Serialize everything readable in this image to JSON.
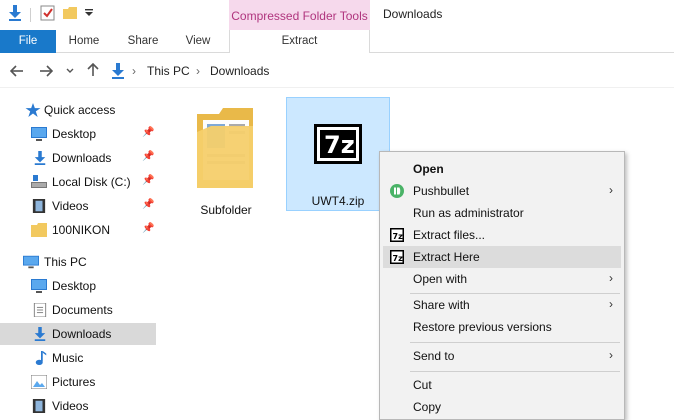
{
  "titlebar": {
    "context_tab": "Compressed Folder Tools",
    "window_title": "Downloads"
  },
  "ribbon": {
    "tabs": [
      {
        "label": "File"
      },
      {
        "label": "Home"
      },
      {
        "label": "Share"
      },
      {
        "label": "View"
      },
      {
        "label": "Extract"
      }
    ]
  },
  "address": {
    "crumbs": [
      "This PC",
      "Downloads"
    ]
  },
  "nav": {
    "quick_access": "Quick access",
    "items": [
      {
        "label": "Desktop",
        "icon": "desktop-icon"
      },
      {
        "label": "Downloads",
        "icon": "download-arrow-icon"
      },
      {
        "label": "Local Disk (C:)",
        "icon": "drive-icon"
      },
      {
        "label": "Videos",
        "icon": "film-icon"
      },
      {
        "label": "100NIKON",
        "icon": "folder-icon"
      }
    ],
    "this_pc": "This PC",
    "pc_items": [
      {
        "label": "Desktop"
      },
      {
        "label": "Documents"
      },
      {
        "label": "Downloads"
      },
      {
        "label": "Music"
      },
      {
        "label": "Pictures"
      },
      {
        "label": "Videos"
      }
    ]
  },
  "files": [
    {
      "name": "Subfolder",
      "icon": "folder-icon"
    },
    {
      "name": "UWT4.zip",
      "icon": "7zip-icon"
    }
  ],
  "context_menu": {
    "items": [
      {
        "label": "Open"
      },
      {
        "label": "Pushbullet"
      },
      {
        "label": "Run as administrator"
      },
      {
        "label": "Extract files..."
      },
      {
        "label": "Extract Here"
      },
      {
        "label": "Open with"
      },
      {
        "label": "Share with"
      },
      {
        "label": "Restore previous versions"
      },
      {
        "label": "Send to"
      },
      {
        "label": "Cut"
      },
      {
        "label": "Copy"
      }
    ]
  },
  "colors": {
    "accent": "#1979ca",
    "context_tab_bg": "#f6d9ec",
    "context_tab_text": "#b0357e",
    "selection": "#cce8ff"
  }
}
